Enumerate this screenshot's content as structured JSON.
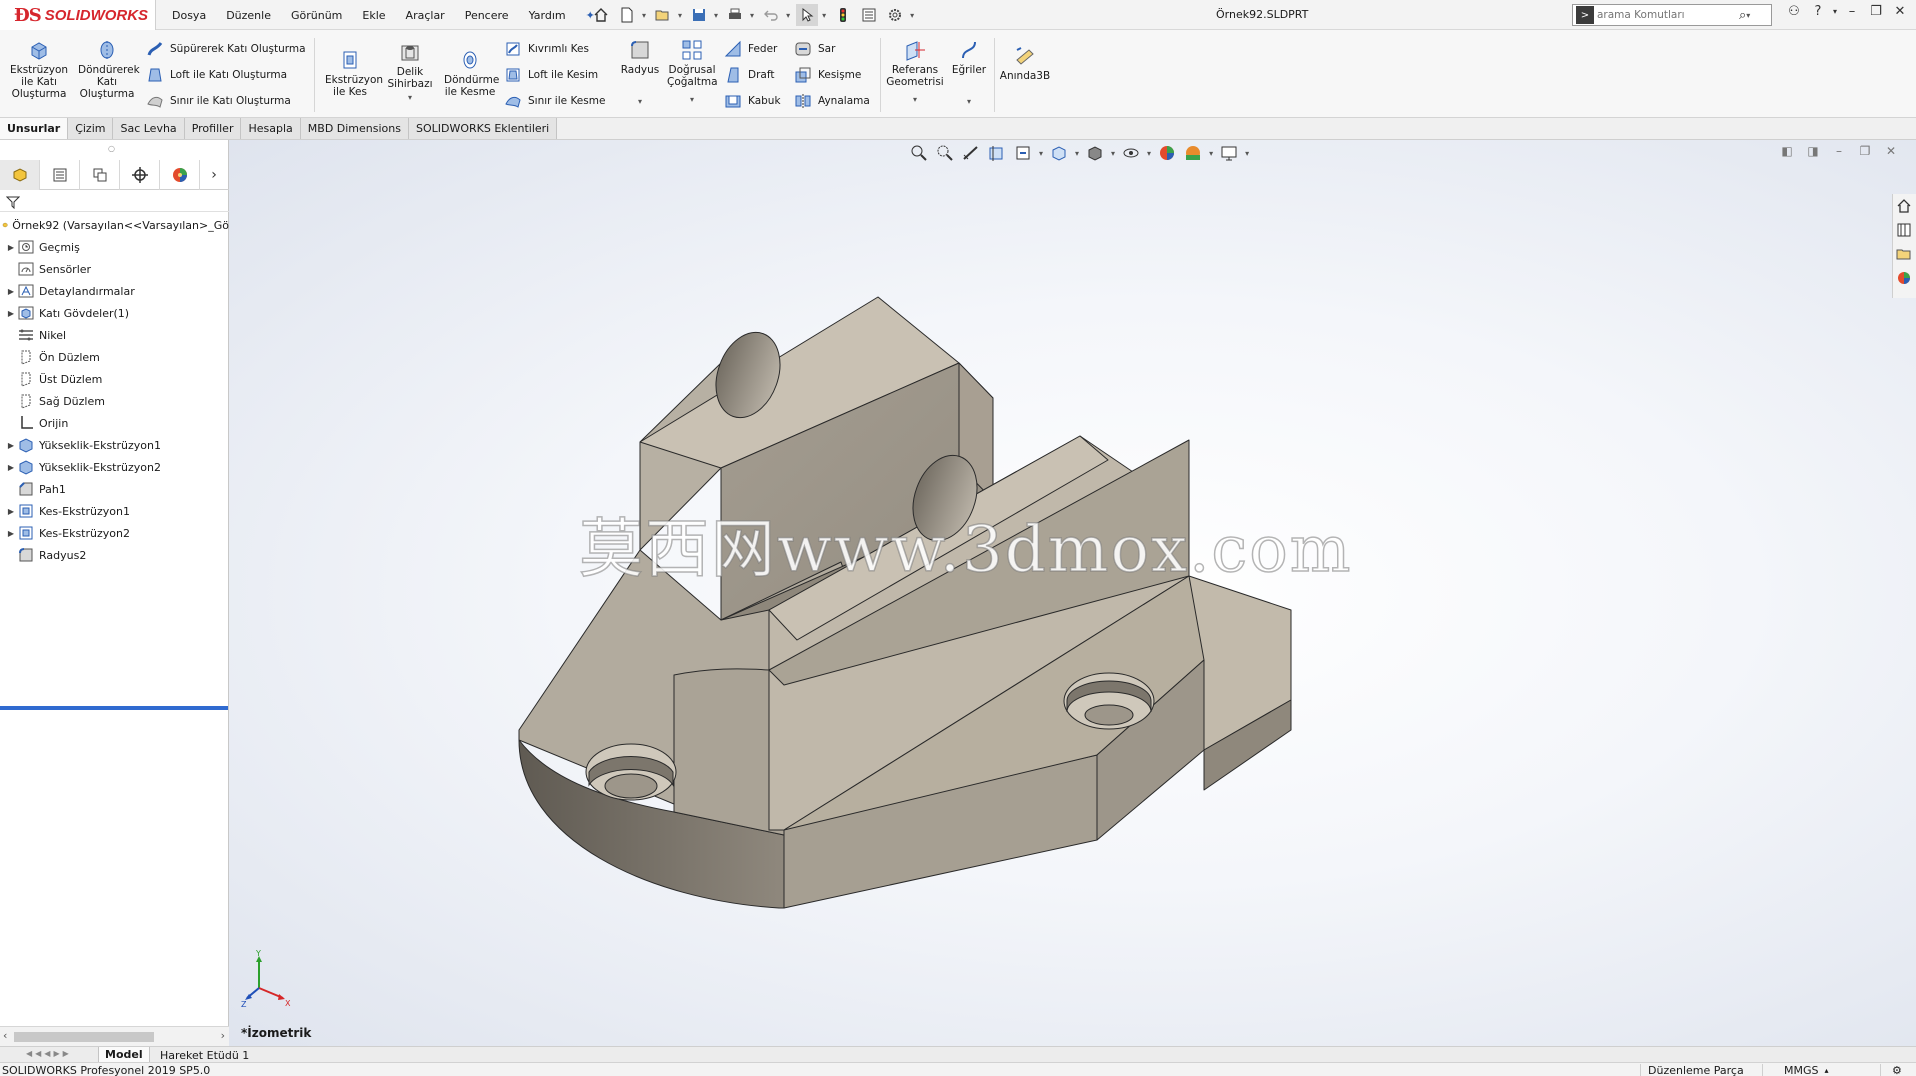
{
  "app": {
    "brand": "SOLIDWORKS",
    "brand_color": "#d6262d"
  },
  "menu": {
    "items": [
      "Dosya",
      "Düzenle",
      "Görünüm",
      "Ekle",
      "Araçlar",
      "Pencere",
      "Yardım"
    ]
  },
  "document": {
    "title": "Örnek92.SLDPRT"
  },
  "search": {
    "placeholder": "arama Komutları"
  },
  "ribbon": {
    "extrude_boss": "Ekstrüzyon ile Katı Oluşturma",
    "revolve_boss": "Döndürerek Katı Oluşturma",
    "swept_boss": "Süpürerek Katı Oluşturma",
    "loft_boss": "Loft ile Katı Oluşturma",
    "boundary_boss": "Sınır ile Katı Oluşturma",
    "extrude_cut": "Ekstrüzyon ile Kes",
    "hole_wizard": "Delik Sihirbazı",
    "revolve_cut": "Döndürme ile Kesme",
    "swept_cut": "Kıvrımlı Kes",
    "loft_cut": "Loft ile Kesim",
    "boundary_cut": "Sınır ile Kesme",
    "fillet": "Radyus",
    "linear_pattern": "Doğrusal Çoğaltma",
    "rib": "Feder",
    "draft": "Draft",
    "shell": "Kabuk",
    "wrap": "Sar",
    "intersect": "Kesişme",
    "mirror": "Aynalama",
    "ref_geometry": "Referans Geometrisi",
    "curves": "Eğriler",
    "instant3d": "Anında3B"
  },
  "cm_tabs": [
    "Unsurlar",
    "Çizim",
    "Sac Levha",
    "Profiller",
    "Hesapla",
    "MBD Dimensions",
    "SOLIDWORKS Eklentileri"
  ],
  "tree": {
    "root": "Örnek92  (Varsayılan<<Varsayılan>_Gö",
    "items": [
      {
        "label": "Geçmiş",
        "expandable": true
      },
      {
        "label": "Sensörler",
        "expandable": false
      },
      {
        "label": "Detaylandırmalar",
        "expandable": true
      },
      {
        "label": "Katı Gövdeler(1)",
        "expandable": true
      },
      {
        "label": "Nikel",
        "expandable": false
      },
      {
        "label": "Ön Düzlem",
        "expandable": false
      },
      {
        "label": "Üst Düzlem",
        "expandable": false
      },
      {
        "label": "Sağ Düzlem",
        "expandable": false
      },
      {
        "label": "Orijin",
        "expandable": false
      },
      {
        "label": "Yükseklik-Ekstrüzyon1",
        "expandable": true
      },
      {
        "label": "Yükseklik-Ekstrüzyon2",
        "expandable": true
      },
      {
        "label": "Pah1",
        "expandable": false
      },
      {
        "label": "Kes-Ekstrüzyon1",
        "expandable": true
      },
      {
        "label": "Kes-Ekstrüzyon2",
        "expandable": true
      },
      {
        "label": "Radyus2",
        "expandable": false
      }
    ]
  },
  "viewport": {
    "watermark": "莫西网www.3dmox.com",
    "view_name": "*İzometrik"
  },
  "bottom_tabs": [
    "Model",
    "Hareket Etüdü 1"
  ],
  "status": {
    "version": "SOLIDWORKS Profesyonel 2019 SP5.0",
    "mode": "Düzenleme Parça",
    "units": "MMGS"
  }
}
